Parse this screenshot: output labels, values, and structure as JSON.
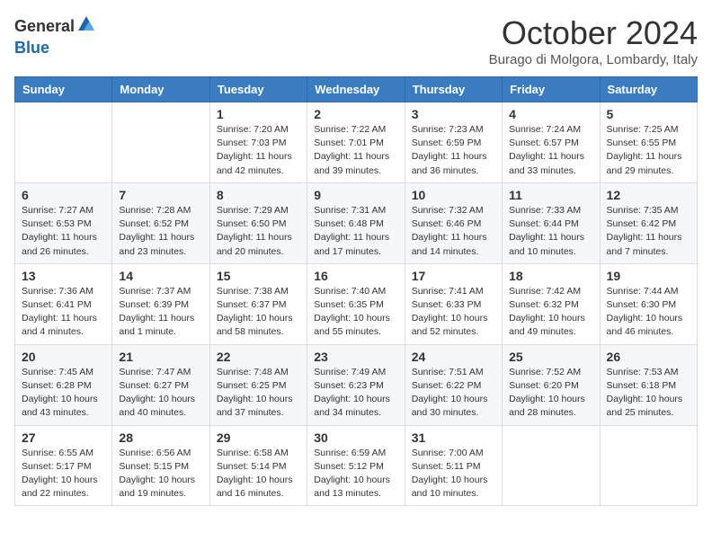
{
  "logo": {
    "general": "General",
    "blue": "Blue"
  },
  "header": {
    "month": "October 2024",
    "location": "Burago di Molgora, Lombardy, Italy"
  },
  "days_of_week": [
    "Sunday",
    "Monday",
    "Tuesday",
    "Wednesday",
    "Thursday",
    "Friday",
    "Saturday"
  ],
  "weeks": [
    [
      {
        "day": "",
        "info": ""
      },
      {
        "day": "",
        "info": ""
      },
      {
        "day": "1",
        "info": "Sunrise: 7:20 AM\nSunset: 7:03 PM\nDaylight: 11 hours and 42 minutes."
      },
      {
        "day": "2",
        "info": "Sunrise: 7:22 AM\nSunset: 7:01 PM\nDaylight: 11 hours and 39 minutes."
      },
      {
        "day": "3",
        "info": "Sunrise: 7:23 AM\nSunset: 6:59 PM\nDaylight: 11 hours and 36 minutes."
      },
      {
        "day": "4",
        "info": "Sunrise: 7:24 AM\nSunset: 6:57 PM\nDaylight: 11 hours and 33 minutes."
      },
      {
        "day": "5",
        "info": "Sunrise: 7:25 AM\nSunset: 6:55 PM\nDaylight: 11 hours and 29 minutes."
      }
    ],
    [
      {
        "day": "6",
        "info": "Sunrise: 7:27 AM\nSunset: 6:53 PM\nDaylight: 11 hours and 26 minutes."
      },
      {
        "day": "7",
        "info": "Sunrise: 7:28 AM\nSunset: 6:52 PM\nDaylight: 11 hours and 23 minutes."
      },
      {
        "day": "8",
        "info": "Sunrise: 7:29 AM\nSunset: 6:50 PM\nDaylight: 11 hours and 20 minutes."
      },
      {
        "day": "9",
        "info": "Sunrise: 7:31 AM\nSunset: 6:48 PM\nDaylight: 11 hours and 17 minutes."
      },
      {
        "day": "10",
        "info": "Sunrise: 7:32 AM\nSunset: 6:46 PM\nDaylight: 11 hours and 14 minutes."
      },
      {
        "day": "11",
        "info": "Sunrise: 7:33 AM\nSunset: 6:44 PM\nDaylight: 11 hours and 10 minutes."
      },
      {
        "day": "12",
        "info": "Sunrise: 7:35 AM\nSunset: 6:42 PM\nDaylight: 11 hours and 7 minutes."
      }
    ],
    [
      {
        "day": "13",
        "info": "Sunrise: 7:36 AM\nSunset: 6:41 PM\nDaylight: 11 hours and 4 minutes."
      },
      {
        "day": "14",
        "info": "Sunrise: 7:37 AM\nSunset: 6:39 PM\nDaylight: 11 hours and 1 minute."
      },
      {
        "day": "15",
        "info": "Sunrise: 7:38 AM\nSunset: 6:37 PM\nDaylight: 10 hours and 58 minutes."
      },
      {
        "day": "16",
        "info": "Sunrise: 7:40 AM\nSunset: 6:35 PM\nDaylight: 10 hours and 55 minutes."
      },
      {
        "day": "17",
        "info": "Sunrise: 7:41 AM\nSunset: 6:33 PM\nDaylight: 10 hours and 52 minutes."
      },
      {
        "day": "18",
        "info": "Sunrise: 7:42 AM\nSunset: 6:32 PM\nDaylight: 10 hours and 49 minutes."
      },
      {
        "day": "19",
        "info": "Sunrise: 7:44 AM\nSunset: 6:30 PM\nDaylight: 10 hours and 46 minutes."
      }
    ],
    [
      {
        "day": "20",
        "info": "Sunrise: 7:45 AM\nSunset: 6:28 PM\nDaylight: 10 hours and 43 minutes."
      },
      {
        "day": "21",
        "info": "Sunrise: 7:47 AM\nSunset: 6:27 PM\nDaylight: 10 hours and 40 minutes."
      },
      {
        "day": "22",
        "info": "Sunrise: 7:48 AM\nSunset: 6:25 PM\nDaylight: 10 hours and 37 minutes."
      },
      {
        "day": "23",
        "info": "Sunrise: 7:49 AM\nSunset: 6:23 PM\nDaylight: 10 hours and 34 minutes."
      },
      {
        "day": "24",
        "info": "Sunrise: 7:51 AM\nSunset: 6:22 PM\nDaylight: 10 hours and 30 minutes."
      },
      {
        "day": "25",
        "info": "Sunrise: 7:52 AM\nSunset: 6:20 PM\nDaylight: 10 hours and 28 minutes."
      },
      {
        "day": "26",
        "info": "Sunrise: 7:53 AM\nSunset: 6:18 PM\nDaylight: 10 hours and 25 minutes."
      }
    ],
    [
      {
        "day": "27",
        "info": "Sunrise: 6:55 AM\nSunset: 5:17 PM\nDaylight: 10 hours and 22 minutes."
      },
      {
        "day": "28",
        "info": "Sunrise: 6:56 AM\nSunset: 5:15 PM\nDaylight: 10 hours and 19 minutes."
      },
      {
        "day": "29",
        "info": "Sunrise: 6:58 AM\nSunset: 5:14 PM\nDaylight: 10 hours and 16 minutes."
      },
      {
        "day": "30",
        "info": "Sunrise: 6:59 AM\nSunset: 5:12 PM\nDaylight: 10 hours and 13 minutes."
      },
      {
        "day": "31",
        "info": "Sunrise: 7:00 AM\nSunset: 5:11 PM\nDaylight: 10 hours and 10 minutes."
      },
      {
        "day": "",
        "info": ""
      },
      {
        "day": "",
        "info": ""
      }
    ]
  ]
}
